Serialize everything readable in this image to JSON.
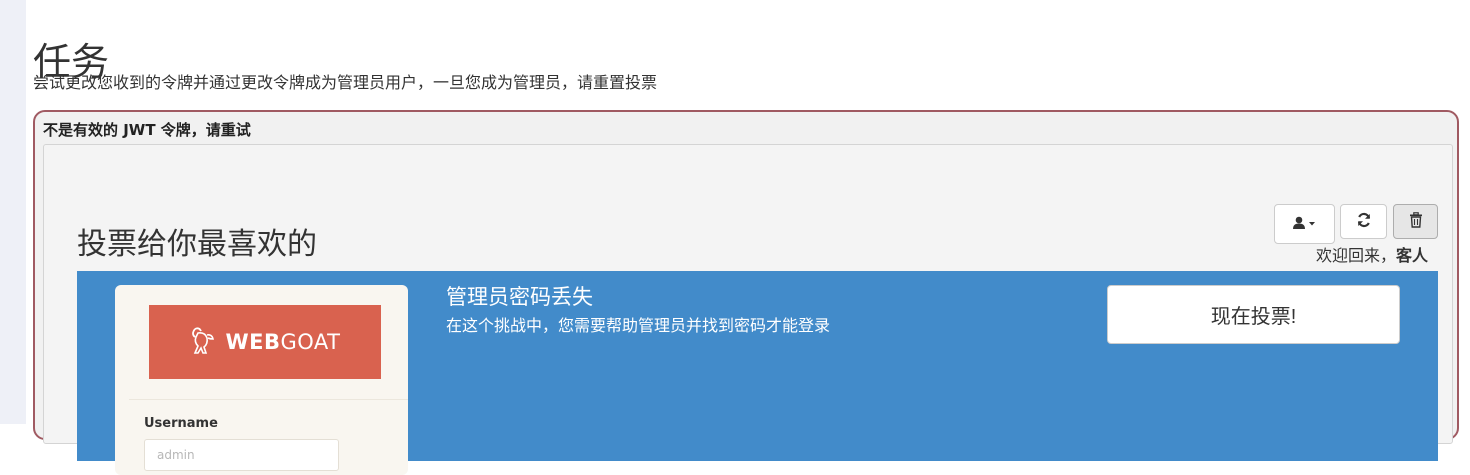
{
  "page": {
    "title": "任务",
    "description": "尝试更改您收到的令牌并通过更改令牌成为管理员用户，一旦您成为管理员，请重置投票"
  },
  "attack": {
    "feedback": "不是有效的 JWT 令牌，请重试",
    "heading": "投票给你最喜欢的",
    "toolbar": {
      "user_icon": "user-icon",
      "refresh_icon": "refresh-icon",
      "trash_icon": "trash-icon"
    },
    "welcome": {
      "text": "欢迎回来，",
      "user": "客人"
    },
    "challenge": {
      "title": "管理员密码丢失",
      "description": "在这个挑战中，您需要帮助管理员并找到密码才能登录",
      "vote_button": "现在投票!",
      "thumbnail": {
        "logo_bold": "WEB",
        "logo_light": "GOAT",
        "username_label": "Username",
        "username_value": "admin"
      }
    }
  },
  "colors": {
    "challenge_bg": "#428bca",
    "logo_bg": "#d9624f",
    "box_border": "#a05a62"
  }
}
